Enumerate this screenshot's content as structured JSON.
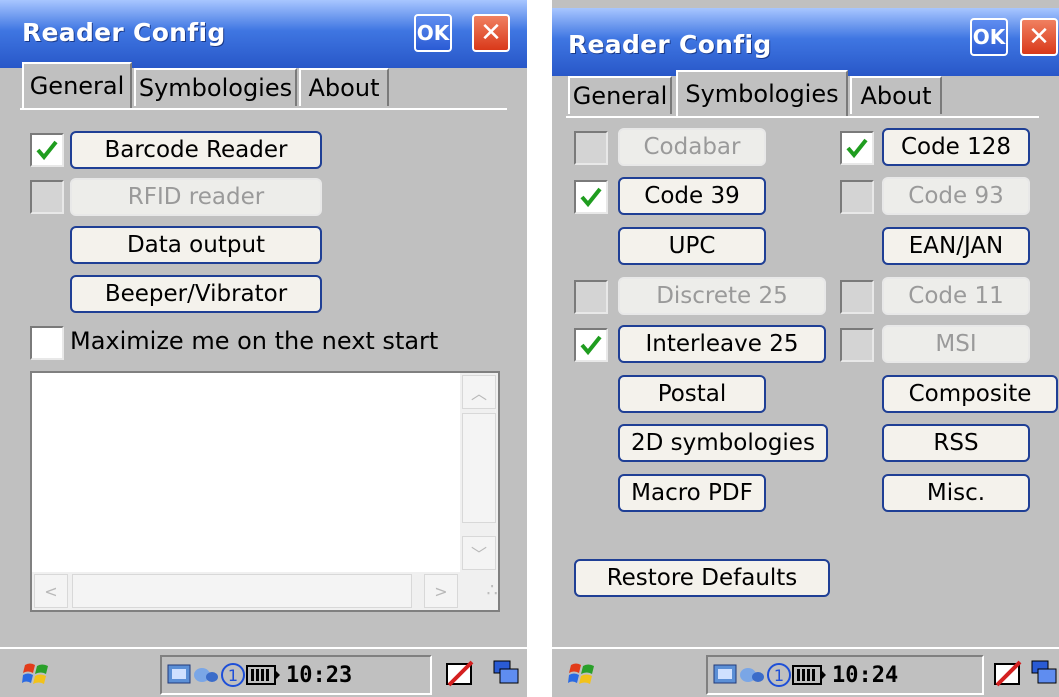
{
  "left_screen": {
    "title": "Reader Config",
    "ok_label": "OK",
    "close_glyph": "✕",
    "tabs": [
      {
        "label": "General",
        "active": true
      },
      {
        "label": "Symbologies",
        "active": false
      },
      {
        "label": "About",
        "active": false
      }
    ],
    "options": [
      {
        "label": "Barcode Reader",
        "checked": true,
        "enabled": true
      },
      {
        "label": "RFID reader",
        "checked": false,
        "enabled": false
      },
      {
        "label": "Data output"
      },
      {
        "label": "Beeper/Vibrator"
      }
    ],
    "maximize_label": "Maximize me on the next start",
    "maximize_checked": false,
    "log_text": "",
    "taskbar": {
      "clock": "10:23"
    }
  },
  "right_screen": {
    "title": "Reader Config",
    "ok_label": "OK",
    "close_glyph": "✕",
    "tabs": [
      {
        "label": "General",
        "active": false
      },
      {
        "label": "Symbologies",
        "active": true
      },
      {
        "label": "About",
        "active": false
      }
    ],
    "symbologies_left": [
      {
        "label": "Codabar",
        "checked": false,
        "enabled": false
      },
      {
        "label": "Code 39",
        "checked": true,
        "enabled": true
      },
      {
        "label": "UPC"
      },
      {
        "label": "Discrete 25",
        "checked": false,
        "enabled": false
      },
      {
        "label": "Interleave 25",
        "checked": true,
        "enabled": true
      },
      {
        "label": "Postal"
      },
      {
        "label": "2D symbologies"
      },
      {
        "label": "Macro PDF"
      }
    ],
    "symbologies_right": [
      {
        "label": "Code 128",
        "checked": true,
        "enabled": true
      },
      {
        "label": "Code 93",
        "checked": false,
        "enabled": false
      },
      {
        "label": "EAN/JAN"
      },
      {
        "label": "Code 11",
        "checked": false,
        "enabled": false
      },
      {
        "label": "MSI",
        "checked": false,
        "enabled": false
      },
      {
        "label": "Composite"
      },
      {
        "label": "RSS"
      },
      {
        "label": "Misc."
      }
    ],
    "restore_label": "Restore Defaults",
    "taskbar": {
      "clock": "10:24"
    }
  },
  "colors": {
    "titlebar": "#3f76e2",
    "dialog_bg": "#c0c0c0",
    "button_border": "#1f3f95",
    "check_green": "#1f9d1f",
    "close_red": "#d9391a"
  },
  "icons": [
    "start-windows-icon",
    "network-icon",
    "connection-icon",
    "battery-icon",
    "sip-keyboard-icon",
    "task-switch-icon"
  ]
}
